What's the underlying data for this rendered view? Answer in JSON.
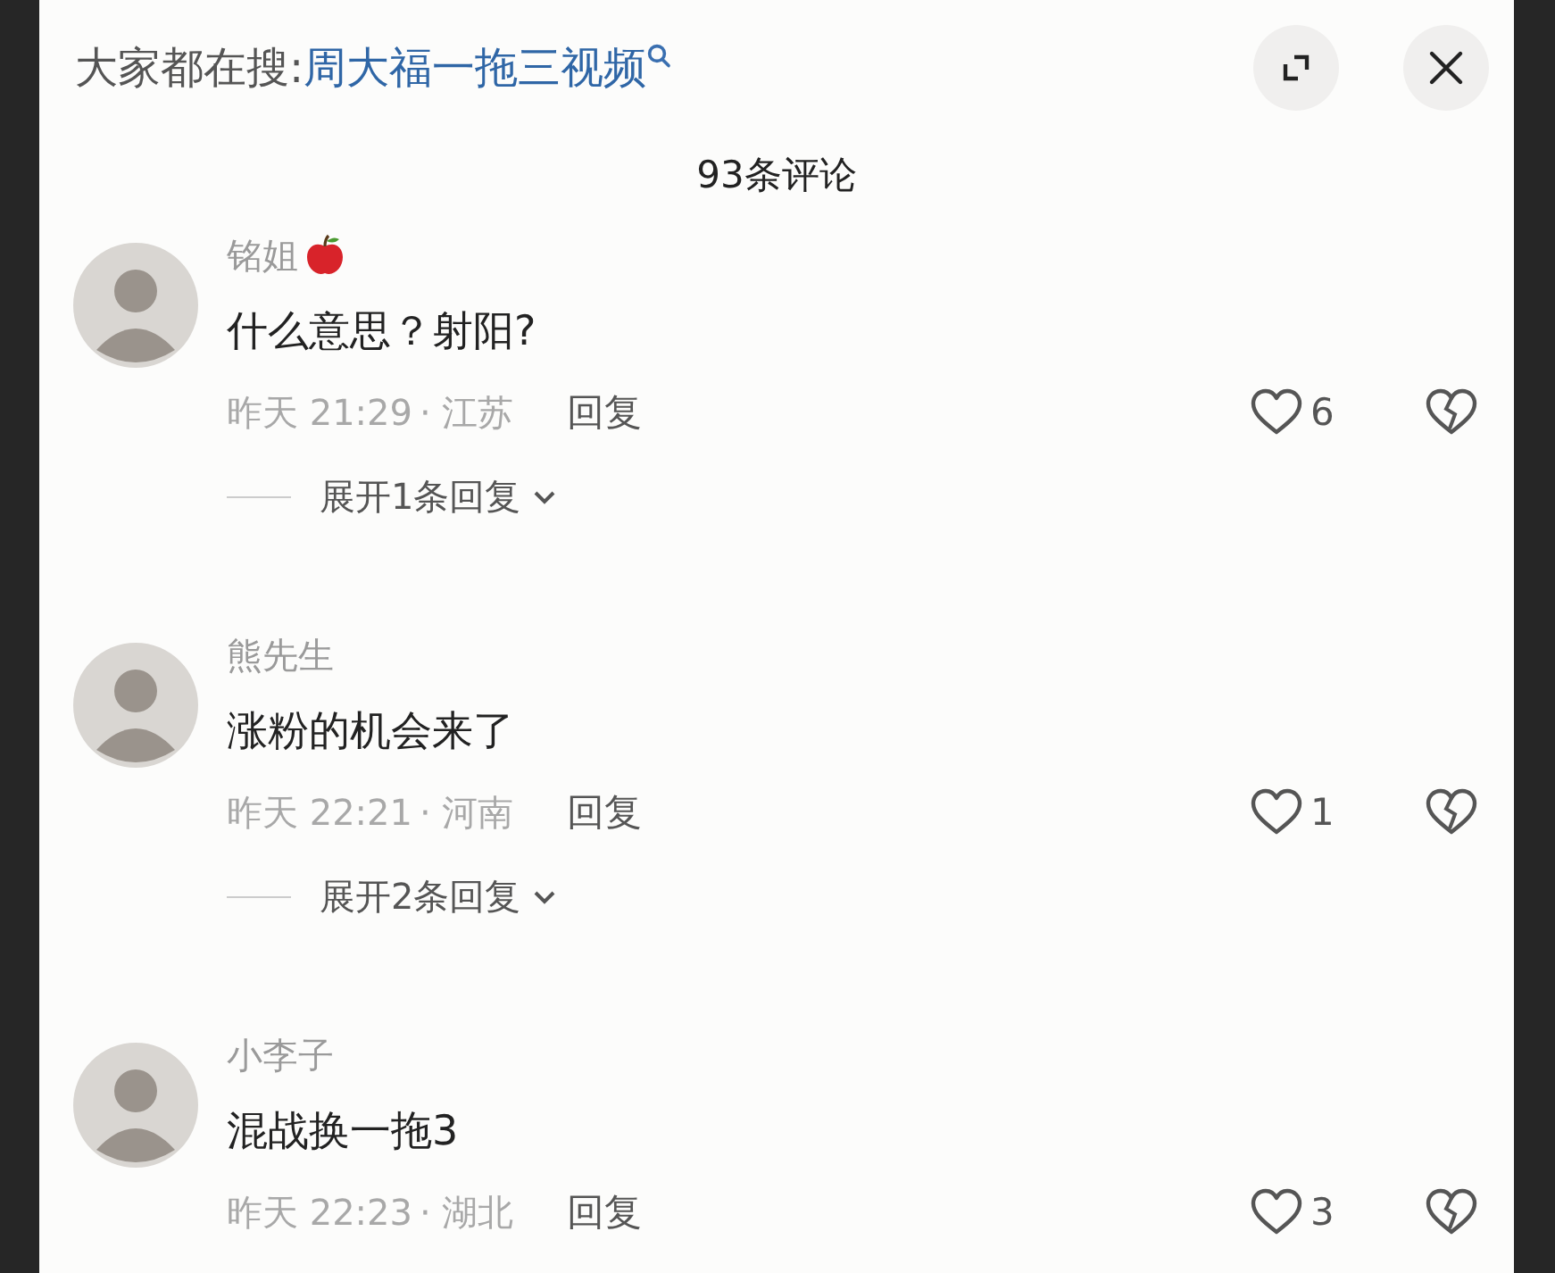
{
  "search_bar": {
    "label": "大家都在搜:",
    "query": "周大福一拖三视频"
  },
  "header": {
    "title": "93条评论"
  },
  "comments": [
    {
      "author": "铭姐",
      "badge": true,
      "text": "什么意思？射阳?",
      "time": "昨天 21:29",
      "location": "· 江苏",
      "reply": "回复",
      "likes": "6",
      "expand": "展开1条回复"
    },
    {
      "author": "熊先生",
      "text": "涨粉的机会来了",
      "time": "昨天 22:21",
      "location": "· 河南",
      "reply": "回复",
      "likes": "1",
      "expand": "展开2条回复"
    },
    {
      "author": "小李子",
      "text": "混战换一拖3",
      "time": "昨天 22:23",
      "location": "· 湖北",
      "reply": "回复",
      "likes": "3"
    }
  ]
}
